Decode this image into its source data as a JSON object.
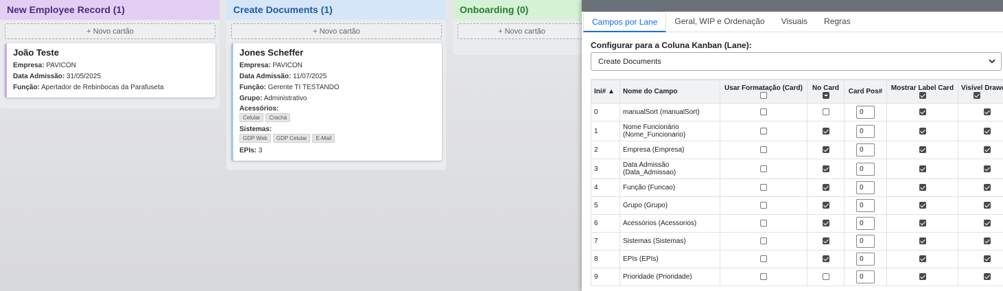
{
  "lanes": [
    {
      "title": "New Employee Record (1)",
      "add_label": "+ Novo cartão",
      "cards": [
        {
          "title": "João Teste",
          "fields": [
            {
              "label": "Empresa:",
              "value": "PAVICON"
            },
            {
              "label": "Data Admissão:",
              "value": "31/05/2025"
            },
            {
              "label": "Função:",
              "value": "Apertador de Rebinbocas da Parafuseta"
            }
          ]
        }
      ]
    },
    {
      "title": "Create Documents (1)",
      "add_label": "+ Novo cartão",
      "cards": [
        {
          "title": "Jones Scheffer",
          "fields": [
            {
              "label": "Empresa:",
              "value": "PAVICON"
            },
            {
              "label": "Data Admissão:",
              "value": "11/07/2025"
            },
            {
              "label": "Função:",
              "value": "Gerente TI TESTANDO"
            },
            {
              "label": "Grupo:",
              "value": "Administrativo"
            }
          ],
          "acessorios_label": "Acessórios:",
          "acessorios": [
            "Celular",
            "Crachá"
          ],
          "sistemas_label": "Sistemas:",
          "sistemas": [
            "GDP Web",
            "GDP Celular",
            "E-Mail"
          ],
          "epis_label": "EPIs:",
          "epis_value": "3"
        }
      ]
    },
    {
      "title": "Onboarding (0)",
      "add_label": "+ Novo cartão",
      "cards": []
    }
  ],
  "panel": {
    "tabs": [
      "Campos por Lane",
      "Geral, WIP e Ordenação",
      "Visuais",
      "Regras"
    ],
    "active_tab": 0,
    "config_label": "Configurar para a Coluna Kanban (Lane):",
    "selected_lane": "Create Documents",
    "columns": [
      "Ini# ▲",
      "Nome do Campo",
      "Usar Formatação (Card)",
      "No Card",
      "Card Pos#",
      "Mostrar Label Card",
      "Visível Drawer"
    ],
    "rows": [
      {
        "idx": "0",
        "name": "manualSort (manualSort)",
        "fmt": false,
        "card": false,
        "pos": "0",
        "label": true,
        "drawer": true
      },
      {
        "idx": "1",
        "name": "Nome Funcionário (Nome_Funcionario)",
        "fmt": false,
        "card": true,
        "pos": "0",
        "label": true,
        "drawer": true
      },
      {
        "idx": "2",
        "name": "Empresa (Empresa)",
        "fmt": false,
        "card": true,
        "pos": "0",
        "label": true,
        "drawer": true
      },
      {
        "idx": "3",
        "name": "Data Admissão (Data_Admissao)",
        "fmt": false,
        "card": true,
        "pos": "0",
        "label": true,
        "drawer": true
      },
      {
        "idx": "4",
        "name": "Função (Funcao)",
        "fmt": false,
        "card": true,
        "pos": "0",
        "label": true,
        "drawer": true
      },
      {
        "idx": "5",
        "name": "Grupo (Grupo)",
        "fmt": false,
        "card": true,
        "pos": "0",
        "label": true,
        "drawer": true
      },
      {
        "idx": "6",
        "name": "Acessórios (Acessorios)",
        "fmt": false,
        "card": true,
        "pos": "0",
        "label": true,
        "drawer": true
      },
      {
        "idx": "7",
        "name": "Sistemas (Sistemas)",
        "fmt": false,
        "card": true,
        "pos": "0",
        "label": true,
        "drawer": true
      },
      {
        "idx": "8",
        "name": "EPIs (EPIs)",
        "fmt": false,
        "card": true,
        "pos": "0",
        "label": true,
        "drawer": true
      },
      {
        "idx": "9",
        "name": "Prioridade (Prioridade)",
        "fmt": false,
        "card": false,
        "pos": "0",
        "label": true,
        "drawer": true
      }
    ]
  }
}
